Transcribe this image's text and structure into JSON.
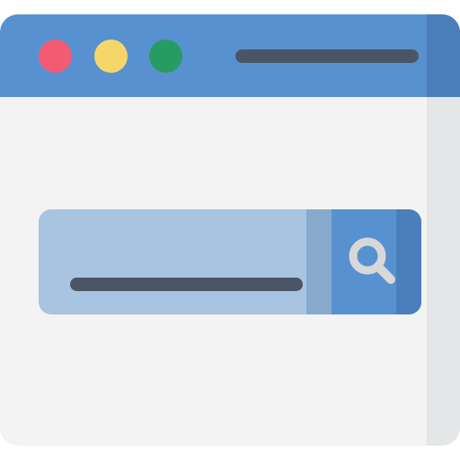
{
  "window": {
    "controls": [
      {
        "name": "close-button",
        "color": "#f35c73"
      },
      {
        "name": "minimize-button",
        "color": "#f5d668"
      },
      {
        "name": "maximize-button",
        "color": "#279c62"
      }
    ],
    "address_bar": {
      "text": ""
    }
  },
  "search": {
    "query": "",
    "button_icon": "search-icon"
  },
  "colors": {
    "titlebar": "#5891d0",
    "titlebar_edge": "#4a7fbb",
    "content_bg": "#f3f3f3",
    "content_edge": "#e5e6e7",
    "search_field": "#a8c4e0",
    "search_divider": "#87a9cc",
    "text_placeholder": "#4a5565",
    "icon": "#d8d8d8"
  }
}
